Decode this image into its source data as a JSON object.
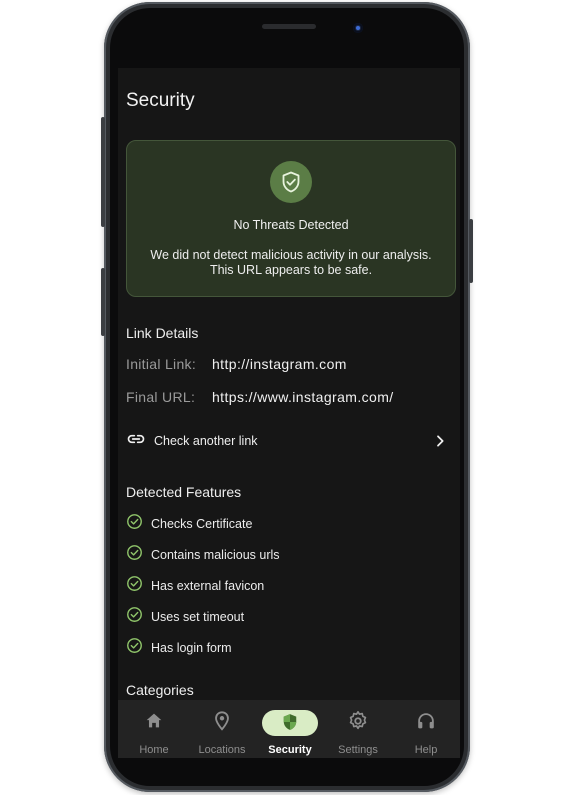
{
  "page": {
    "title": "Security"
  },
  "status": {
    "heading": "No Threats Detected",
    "message": "We did not detect malicious activity in our analysis. This URL appears to be safe.",
    "color": "#5b7d46"
  },
  "link_details": {
    "heading": "Link Details",
    "initial_label": "Initial Link:",
    "initial_value": "http://instagram.com",
    "final_label": "Final URL:",
    "final_value": "https://www.instagram.com/"
  },
  "check_another": {
    "label": "Check another link",
    "icon": "link-icon"
  },
  "detected_features": {
    "heading": "Detected Features",
    "items": [
      {
        "label": "Checks Certificate"
      },
      {
        "label": "Contains malicious urls"
      },
      {
        "label": "Has external favicon"
      },
      {
        "label": "Uses set timeout"
      },
      {
        "label": "Has login form"
      }
    ]
  },
  "categories": {
    "heading": "Categories"
  },
  "nav": {
    "items": [
      {
        "label": "Home",
        "icon": "home-icon"
      },
      {
        "label": "Locations",
        "icon": "location-pin-icon"
      },
      {
        "label": "Security",
        "icon": "shield-icon",
        "active": true
      },
      {
        "label": "Settings",
        "icon": "gear-icon"
      },
      {
        "label": "Help",
        "icon": "headset-icon"
      }
    ],
    "active_pill_color": "#d9ecc5"
  }
}
